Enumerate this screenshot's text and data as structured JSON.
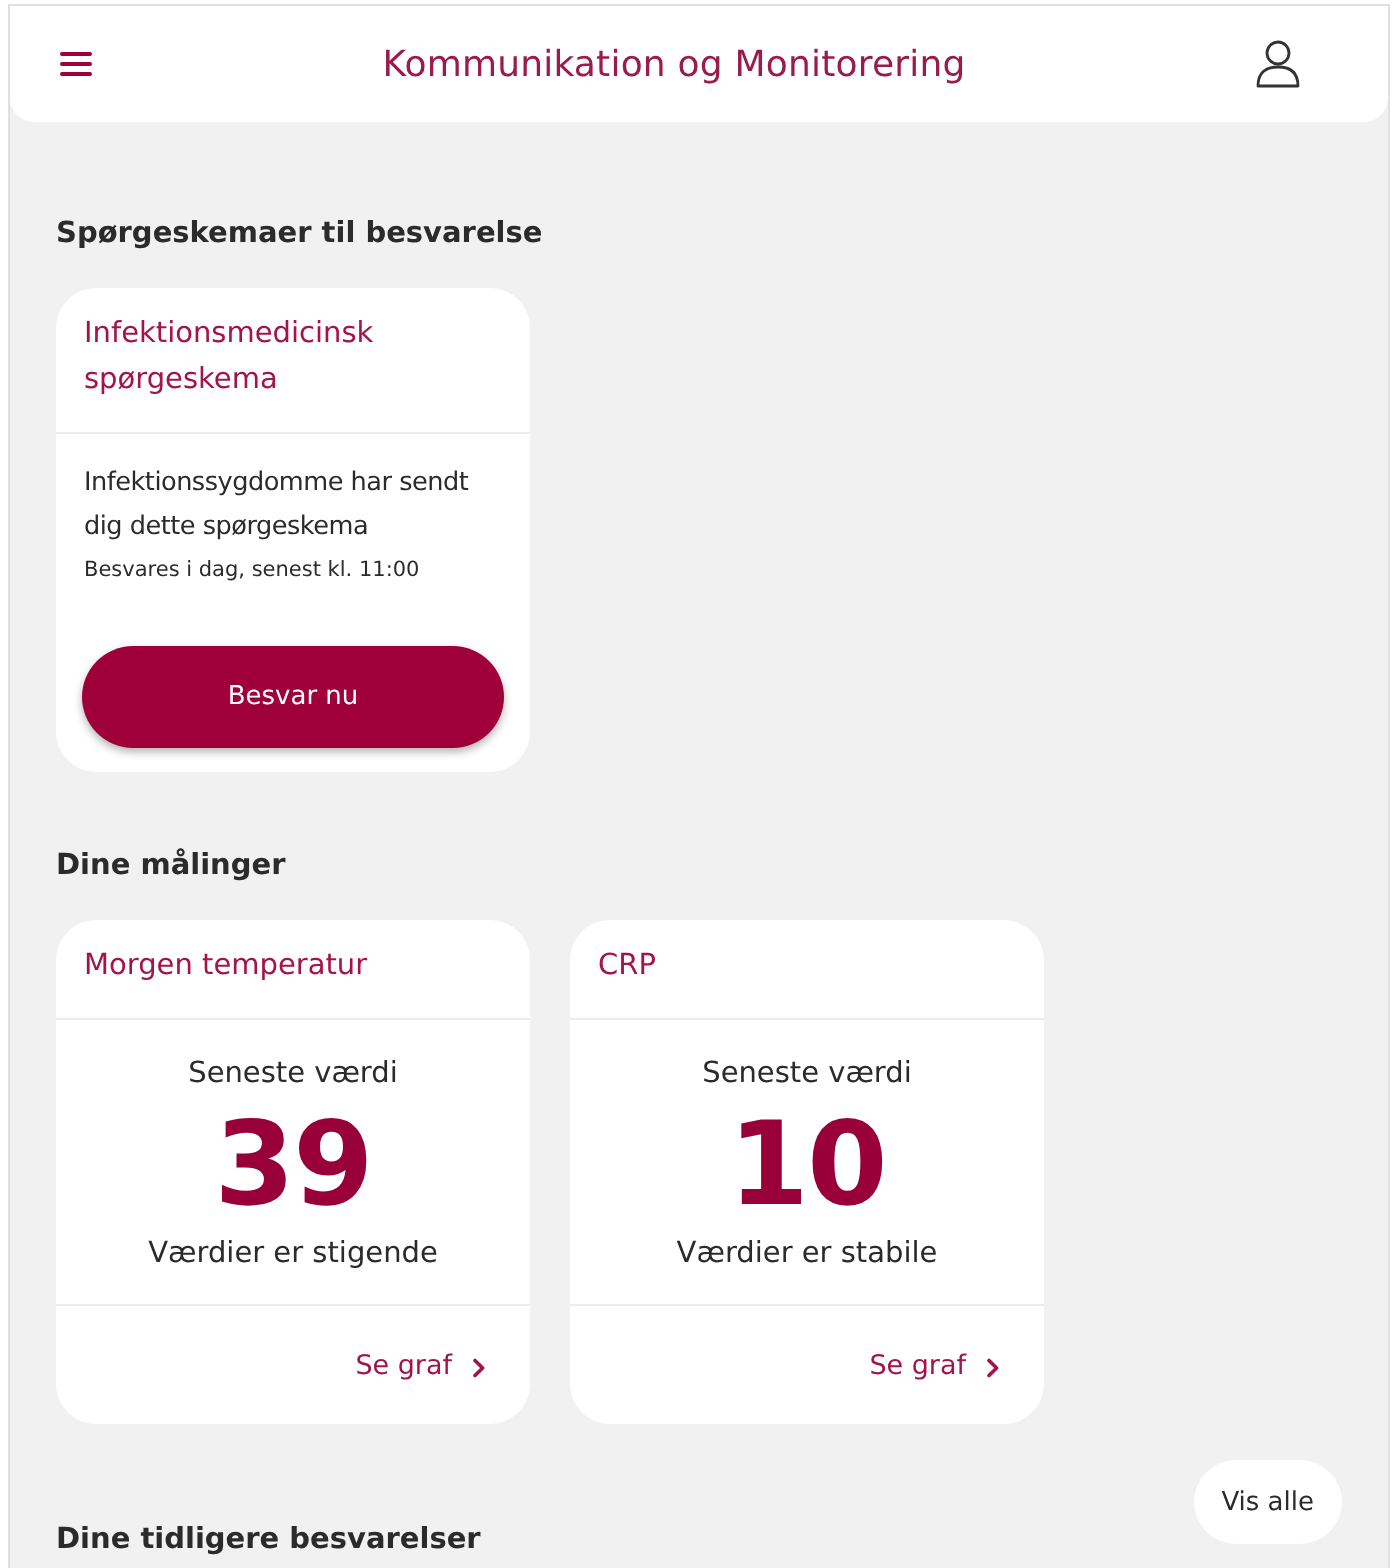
{
  "header": {
    "title": "Kommunikation og Monitorering"
  },
  "questionnaires": {
    "heading": "Spørgeskemaer til besvarelse",
    "cards": [
      {
        "title": "Infektionsmedicinsk spørgeskema",
        "message": "Infektionssygdomme har sendt dig dette spørgeskema",
        "deadline": "Besvares i dag, senest kl. 11:00",
        "button": "Besvar nu"
      }
    ]
  },
  "measurements": {
    "heading": "Dine målinger",
    "cards": [
      {
        "title": "Morgen temperatur",
        "caption": "Seneste værdi",
        "value": "39",
        "trend": "Værdier er stigende",
        "link": "Se graf"
      },
      {
        "title": "CRP",
        "caption": "Seneste værdi",
        "value": "10",
        "trend": "Værdier er stabile",
        "link": "Se graf"
      }
    ]
  },
  "previous": {
    "heading": "Dine tidligere besvarelser",
    "button": "Vis alle"
  }
}
